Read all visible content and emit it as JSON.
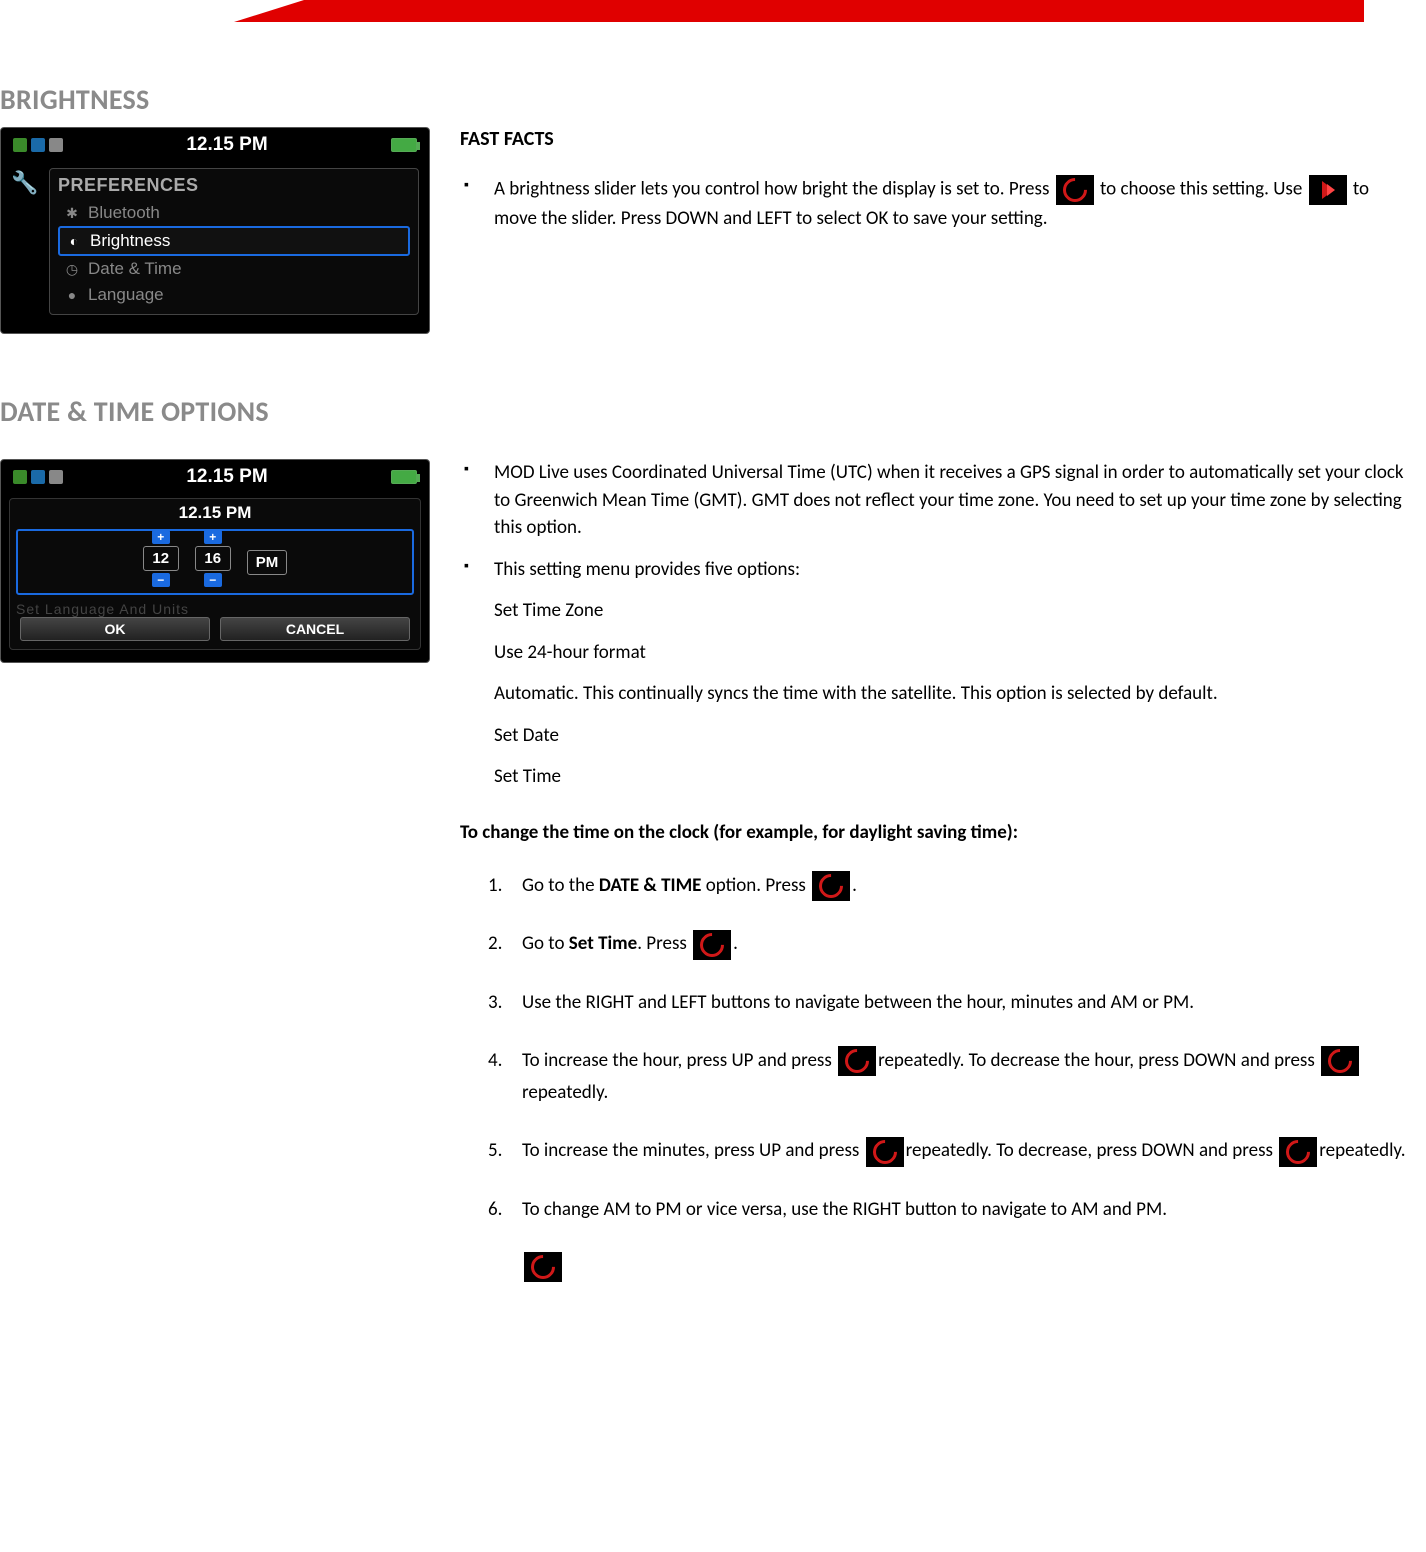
{
  "sections": {
    "brightness": {
      "title": "BRIGHTNESS",
      "fast_facts_label": "FAST FACTS",
      "facts": {
        "f1a": "A brightness slider lets you control how bright the display is set to. Press ",
        "f1b": " to choose this setting. Use ",
        "f1c": " to move the slider. Press DOWN and LEFT to select OK to save your setting."
      },
      "screenshot": {
        "time": "12.15 PM",
        "header": "PREFERENCES",
        "items": [
          "Bluetooth",
          "Brightness",
          "Date & Time",
          "Language"
        ],
        "selected_index": 1
      }
    },
    "datetime": {
      "title": "DATE & TIME OPTIONS",
      "bullets": {
        "b1": "MOD Live uses Coordinated Universal Time (UTC) when it receives a GPS signal in order to automatically set your clock to Greenwich Mean Time (GMT). GMT does not reflect your time zone. You need to set up your time zone by selecting this option.",
        "b2": "This setting menu provides five options:"
      },
      "options": [
        "Set Time Zone",
        "Use 24-hour format",
        "Automatic. This continually syncs the time with the satellite. This option is selected by default.",
        "Set Date",
        "Set Time"
      ],
      "change_hdr": "To change the time on the clock (for example, for daylight saving time):",
      "steps": {
        "s1a": "Go to the ",
        "s1b": "DATE & TIME",
        "s1c": " option. Press ",
        "s1d": ".",
        "s2a": "Go to ",
        "s2b": "Set Time",
        "s2c": ". Press ",
        "s2d": ".",
        "s3": "Use the RIGHT and LEFT buttons to navigate between the hour, minutes and AM or PM.",
        "s4a": "To increase the hour, press UP and press ",
        "s4b": "repeatedly. To decrease the hour, press DOWN and press ",
        "s4c": "repeatedly.",
        "s5a": "To increase the minutes, press UP and press ",
        "s5b": "repeatedly. To decrease, press DOWN and press ",
        "s5c": "repeatedly.",
        "s6": "To change AM to PM or vice versa, use the RIGHT button to navigate to AM and PM."
      },
      "screenshot": {
        "time_top": "12.15 PM",
        "time_inner": "12.15 PM",
        "hour": "12",
        "minute": "16",
        "ampm": "PM",
        "ok": "OK",
        "cancel": "CANCEL"
      }
    }
  }
}
